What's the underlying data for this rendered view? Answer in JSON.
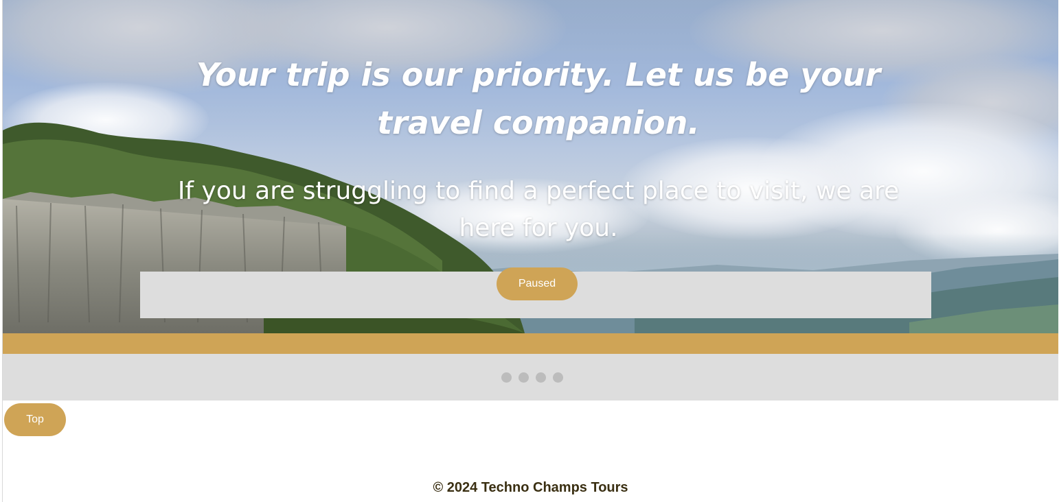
{
  "hero": {
    "title": "Your trip is our priority. Let us be your travel companion.",
    "subtitle": "If you are struggling to find a perfect place to visit, we are here for you."
  },
  "slideshow": {
    "pause_label": "Paused",
    "dot_count": 4
  },
  "navigation": {
    "top_label": "Top"
  },
  "footer": {
    "copyright": "© 2024 Techno Champs Tours"
  },
  "colors": {
    "accent": "#cfa456",
    "panel": "#dddddd",
    "dot": "#bcbcbc",
    "footer_text": "#3a2f12"
  }
}
